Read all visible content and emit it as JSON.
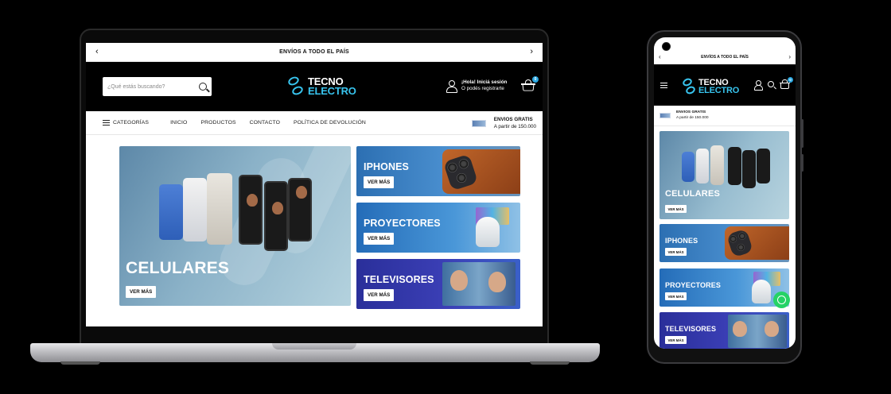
{
  "store": {
    "announcement": "ENVÍOS A TODO EL PAÍS",
    "search_placeholder": "¿Qué estás buscando?",
    "logo_line1": "TECNO",
    "logo_line2": "ELECTRO",
    "user_greeting": "¡Hola! Iniciá sesión",
    "user_register": "O podés registrarte",
    "cart_count": "0",
    "nav": {
      "categories": "CATEGORÍAS",
      "items": [
        "INICIO",
        "PRODUCTOS",
        "CONTACTO",
        "POLÍTICA DE DEVOLUCIÓN"
      ]
    },
    "shipping_title": "ENVIOS GRATIS",
    "shipping_sub": "A partir de 150.000",
    "shipping_sub_mobile": "A partir de 150.000",
    "hero": {
      "title": "CELULARES",
      "cta": "VER MÁS"
    },
    "banners": [
      {
        "title": "IPHONES",
        "cta": "VER MÁS"
      },
      {
        "title": "PROYECTORES",
        "cta": "VER MÁS"
      },
      {
        "title": "TELEVISORES",
        "cta": "VER MÁS"
      }
    ]
  },
  "icons": {
    "prev": "chevron-left-icon",
    "next": "chevron-right-icon",
    "search": "search-icon",
    "user": "user-icon",
    "cart": "cart-icon",
    "menu": "menu-icon",
    "truck": "truck-icon",
    "whatsapp": "whatsapp-icon"
  },
  "colors": {
    "accent": "#38c4ee",
    "header_bg": "#000000",
    "badge": "#2aa7e0",
    "whatsapp": "#25d366"
  }
}
